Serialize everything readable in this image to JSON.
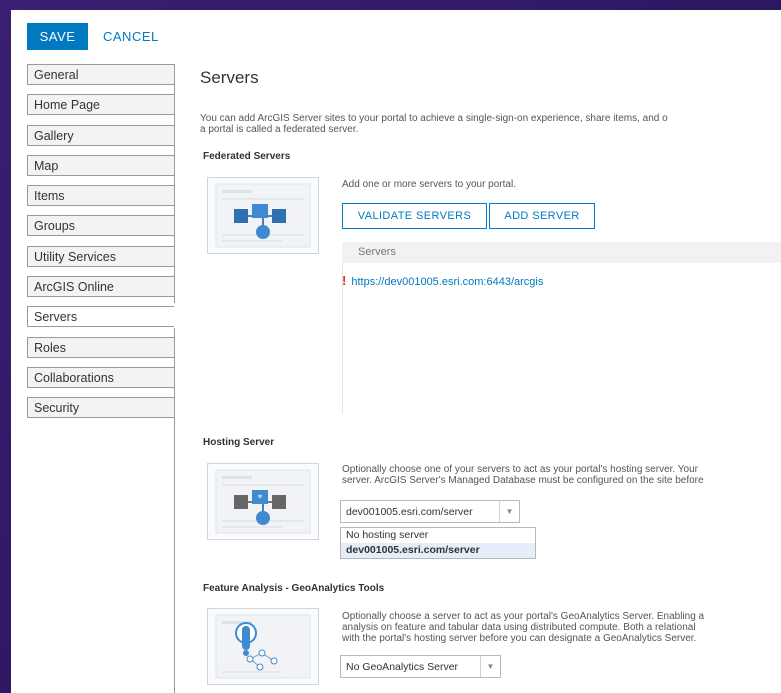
{
  "toolbar": {
    "save_label": "SAVE",
    "cancel_label": "CANCEL"
  },
  "sidebar": {
    "items": [
      {
        "label": "General"
      },
      {
        "label": "Home Page"
      },
      {
        "label": "Gallery"
      },
      {
        "label": "Map"
      },
      {
        "label": "Items"
      },
      {
        "label": "Groups"
      },
      {
        "label": "Utility Services"
      },
      {
        "label": "ArcGIS Online"
      },
      {
        "label": "Servers",
        "active": true
      },
      {
        "label": "Roles"
      },
      {
        "label": "Collaborations"
      },
      {
        "label": "Security"
      }
    ]
  },
  "main": {
    "title": "Servers",
    "intro_line1": "You can add ArcGIS Server sites to your portal to achieve a single-sign-on experience, share items, and o",
    "intro_line2": "a portal is called a federated server.",
    "federated": {
      "heading": "Federated Servers",
      "description": "Add one or more servers to your portal.",
      "validate_label": "VALIDATE SERVERS",
      "add_label": "ADD SERVER",
      "table_header": "Servers",
      "rows": [
        {
          "url": "https://dev001005.esri.com:6443/arcgis",
          "warning": "!"
        }
      ]
    },
    "hosting": {
      "heading": "Hosting Server",
      "description_line1": "Optionally choose one of your servers to act as your portal's hosting server. Your",
      "description_line2": "server. ArcGIS Server's Managed Database must be configured on the site before",
      "selected": "dev001005.esri.com/server",
      "options": [
        "No hosting server",
        "dev001005.esri.com/server"
      ]
    },
    "geoanalytics": {
      "heading": "Feature Analysis - GeoAnalytics Tools",
      "description_line1": "Optionally choose a server to act as your portal's GeoAnalytics Server. Enabling a",
      "description_line2": "analysis on feature and tabular data using distributed compute. Both a relational",
      "description_line3": "with the portal's hosting server before you can designate a GeoAnalytics Server.",
      "selected": "No GeoAnalytics Server"
    }
  },
  "colors": {
    "accent": "#0079c1",
    "warning": "#d83020",
    "frame": "#2a1660"
  }
}
